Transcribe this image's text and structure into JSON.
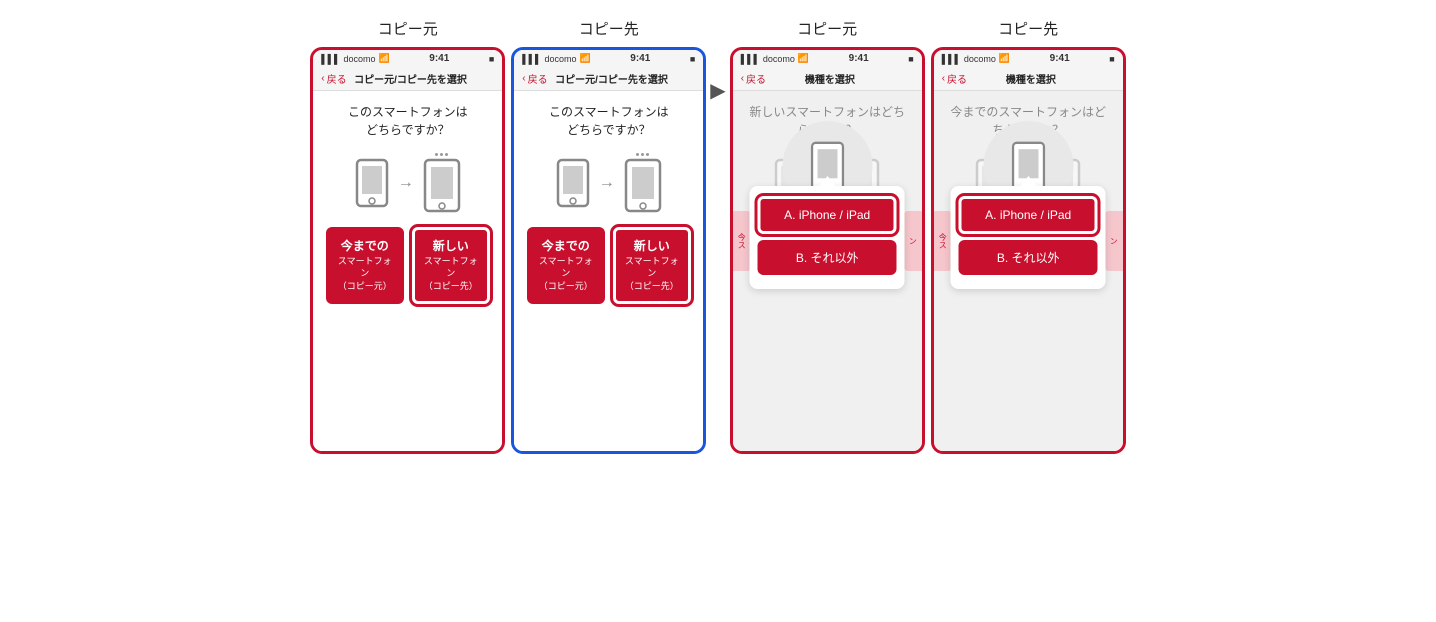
{
  "sections": [
    {
      "id": "copy-source-1",
      "label": "コピー元",
      "frame_color": "red",
      "status": {
        "carrier": "docomo",
        "wifi": true,
        "time": "9:41",
        "battery": "■"
      },
      "nav": {
        "back": "戻る",
        "title": "コピー元/コピー先を選択"
      },
      "question": "このスマートフォンは\nどちらですか？",
      "buttons": [
        {
          "main": "今までの",
          "sub": "スマートフォン",
          "sub2": "（コピー元）",
          "selected": false
        },
        {
          "main": "新しい",
          "sub": "スマートフォン",
          "sub2": "（コピー先）",
          "selected": true
        }
      ]
    },
    {
      "id": "copy-dest-1",
      "label": "コピー先",
      "frame_color": "blue",
      "status": {
        "carrier": "docomo",
        "wifi": true,
        "time": "9:41",
        "battery": "■"
      },
      "nav": {
        "back": "戻る",
        "title": "コピー元/コピー先を選択"
      },
      "question": "このスマートフォンは\nどちらですか？",
      "buttons": [
        {
          "main": "今までの",
          "sub": "スマートフォン",
          "sub2": "（コピー元）",
          "selected": false
        },
        {
          "main": "新しい",
          "sub": "スマートフォン",
          "sub2": "（コピー先）",
          "selected": true
        }
      ]
    }
  ],
  "sections2": [
    {
      "id": "copy-source-2",
      "label": "コピー元",
      "frame_color": "red",
      "status": {
        "carrier": "docomo",
        "wifi": true,
        "time": "9:41",
        "battery": "■"
      },
      "nav": {
        "back": "戻る",
        "title": "機種を選択"
      },
      "question": "新しいスマートフォンはどち\nらですか？",
      "popup": {
        "option_a": "A. iPhone / iPad",
        "option_b": "B. それ以外"
      }
    },
    {
      "id": "copy-dest-2",
      "label": "コピー先",
      "frame_color": "red",
      "status": {
        "carrier": "docomo",
        "wifi": true,
        "time": "9:41",
        "battery": "■"
      },
      "nav": {
        "back": "戻る",
        "title": "機種を選択"
      },
      "question": "今までのスマートフォンはど\nちらですか？",
      "popup": {
        "option_a": "A. iPhone / iPad",
        "option_b": "B. それ以外"
      }
    }
  ],
  "arrow": "▶",
  "labels": {
    "copy_source": "コピー元",
    "copy_dest": "コピー先"
  }
}
